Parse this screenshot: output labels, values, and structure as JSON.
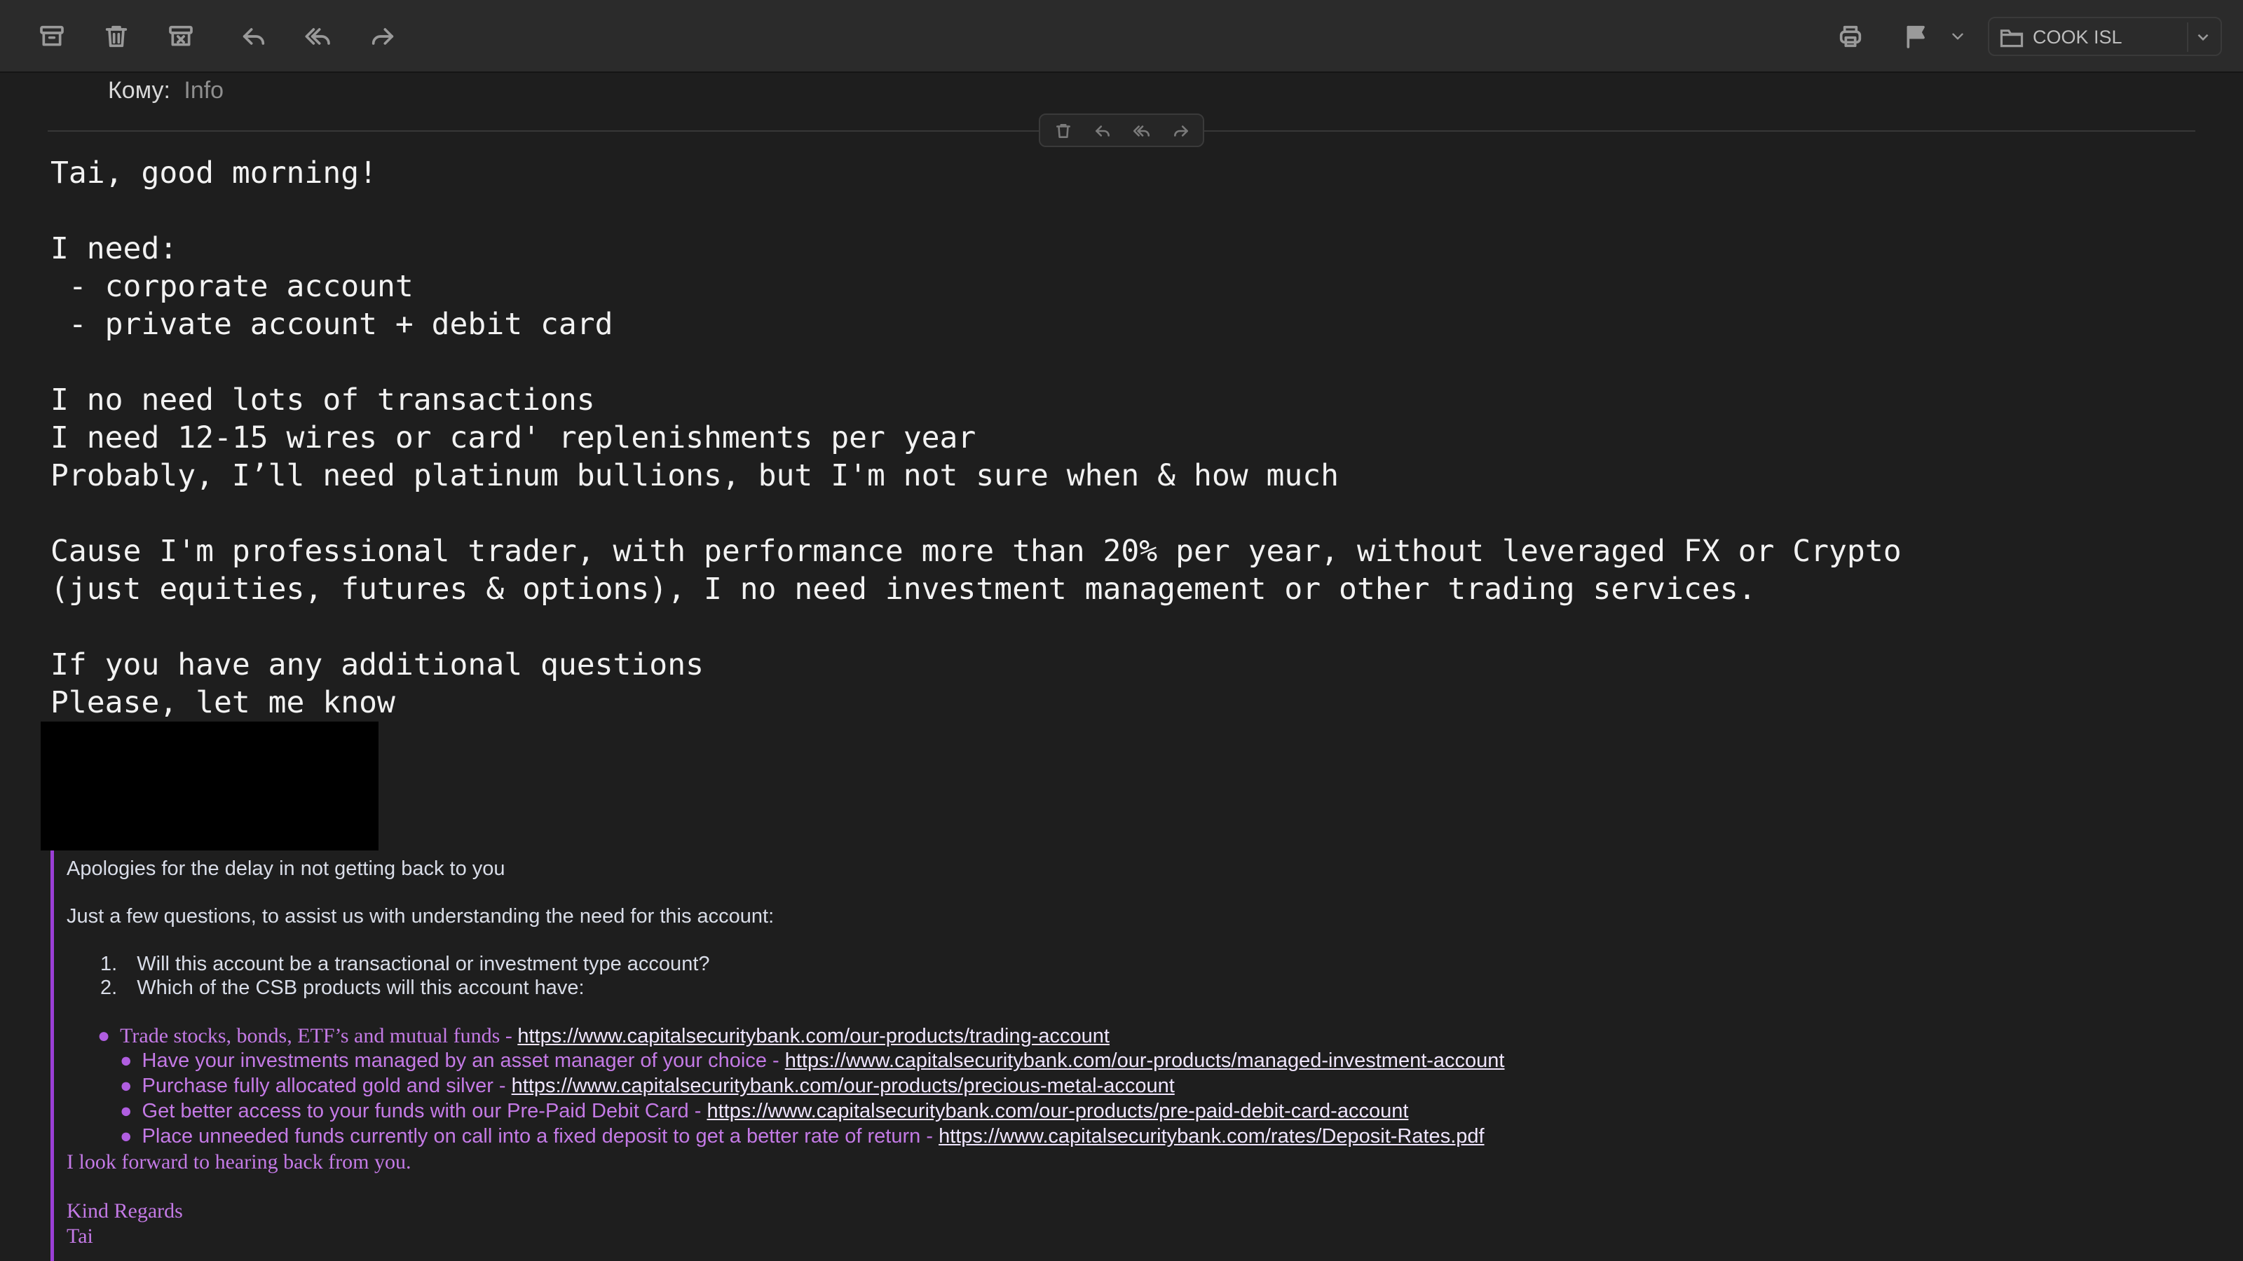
{
  "toolbar": {
    "buttons": [
      "archive-icon",
      "trash-icon",
      "junk-icon",
      "reply-icon",
      "reply-all-icon",
      "forward-icon",
      "print-icon",
      "flag-icon",
      "chevron-down-icon"
    ],
    "folder_label": "COOK ISL"
  },
  "header": {
    "to_label": "Кому:",
    "to_value": "Info"
  },
  "body": {
    "text": "Tai, good morning!\n\nI need:\n - corporate account\n - private account + debit card\n\nI no need lots of transactions\nI need 12-15 wires or card' replenishments per year\nProbably, I’ll need platinum bullions, but I'm not sure when & how much\n\nCause I'm professional trader, with performance more than 20% per year, without leveraged FX or Crypto\n(just equities, futures & options), I no need investment management or other trading services.\n\nIf you have any additional questions\nPlease, let me know"
  },
  "quoted": {
    "apology": "Apologies for the delay in not getting back to you",
    "intro": "Just a few questions, to assist us with understanding the need for this account:",
    "questions": [
      {
        "num": "1.",
        "text": "Will this account be a transactional or investment type account?"
      },
      {
        "num": "2.",
        "text": "Which of the CSB products will this account have:"
      }
    ],
    "products": [
      {
        "text": "Trade stocks, bonds, ETF’s and mutual funds - ",
        "url": "https://www.capitalsecuritybank.com/our-products/trading-account"
      },
      {
        "text": "Have your investments managed by an asset manager of your choice - ",
        "url": "https://www.capitalsecuritybank.com/our-products/managed-investment-account"
      },
      {
        "text": "Purchase fully allocated gold and silver - ",
        "url": "https://www.capitalsecuritybank.com/our-products/precious-metal-account"
      },
      {
        "text": "Get better access to your funds with our Pre-Paid Debit Card - ",
        "url": "https://www.capitalsecuritybank.com/our-products/pre-paid-debit-card-account"
      },
      {
        "text": "Place unneeded funds currently on call into a fixed deposit to get a better rate of return - ",
        "url": "https://www.capitalsecuritybank.com/rates/Deposit-Rates.pdf"
      }
    ],
    "closing": "I look forward to hearing back from you.",
    "regards": "Kind Regards",
    "signature": "Tai"
  },
  "colors": {
    "background": "#1e1e1e",
    "quote_bar": "#9b3fd6",
    "quote_text": "#c47ae6"
  }
}
